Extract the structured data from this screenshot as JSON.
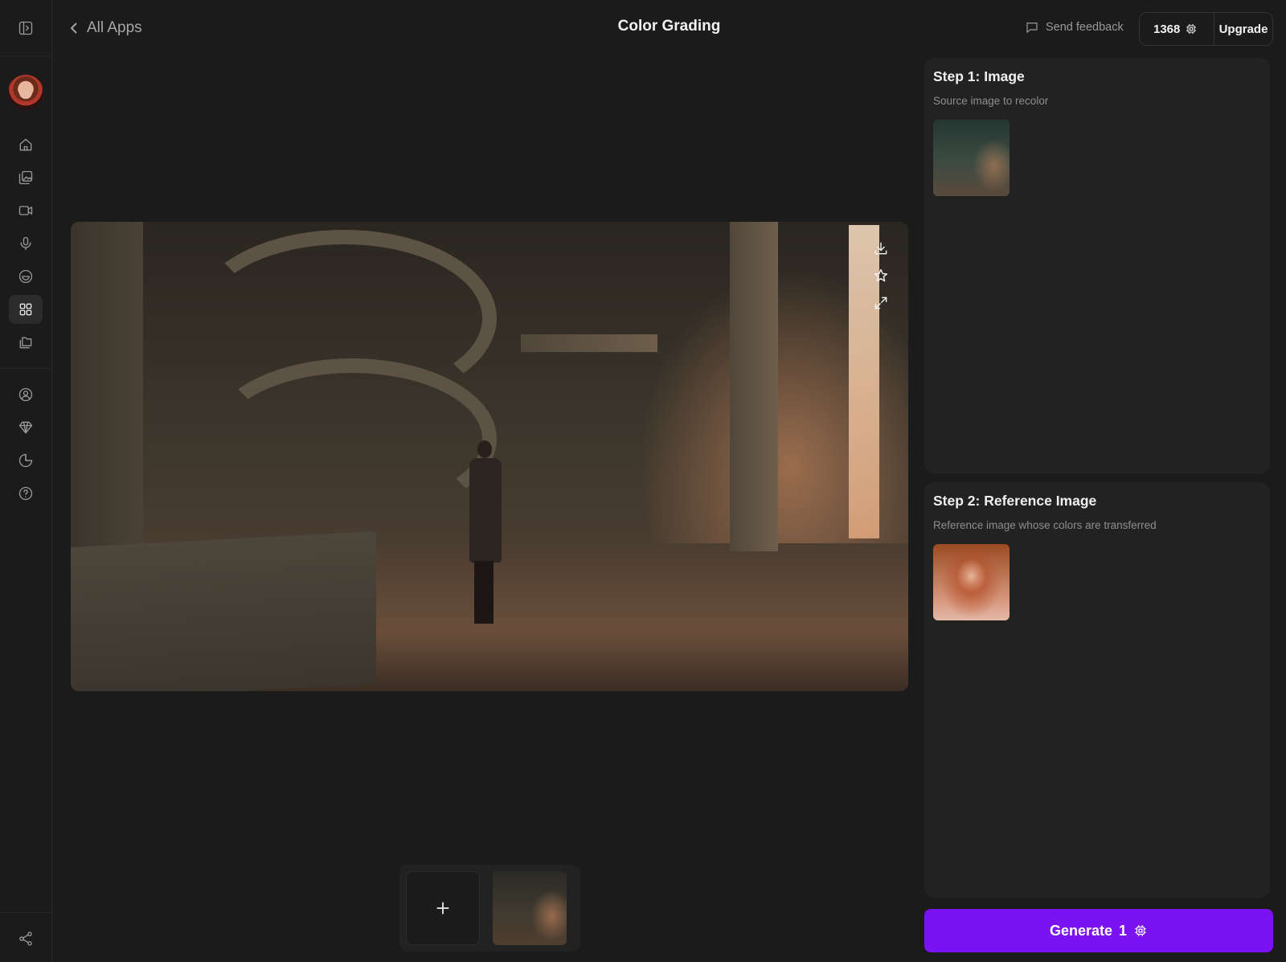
{
  "header": {
    "back_label": "All Apps",
    "title": "Color Grading",
    "feedback_label": "Send feedback",
    "credits": "1368",
    "upgrade_label": "Upgrade"
  },
  "sidebar": {
    "top_icon": "sidebar-toggle-icon",
    "items": [
      {
        "icon": "home-icon"
      },
      {
        "icon": "image-gallery-icon"
      },
      {
        "icon": "video-icon"
      },
      {
        "icon": "microphone-icon"
      },
      {
        "icon": "smiley-icon"
      },
      {
        "icon": "apps-grid-icon",
        "active": true
      },
      {
        "icon": "folders-icon"
      },
      {
        "icon": "user-circle-icon"
      },
      {
        "icon": "diamond-icon"
      },
      {
        "icon": "pie-chart-icon"
      },
      {
        "icon": "help-icon"
      }
    ],
    "bottom_icon": "share-icon"
  },
  "preview": {
    "tools": [
      "download-icon",
      "star-icon",
      "expand-icon"
    ]
  },
  "steps": [
    {
      "title": "Step 1: Image",
      "description": "Source image to recolor"
    },
    {
      "title": "Step 2: Reference Image",
      "description": "Reference image whose colors are transferred"
    }
  ],
  "generate": {
    "label": "Generate",
    "cost": "1"
  },
  "colors": {
    "background": "#1b1b1b",
    "panel": "#222222",
    "accent": "#7a12f2"
  }
}
